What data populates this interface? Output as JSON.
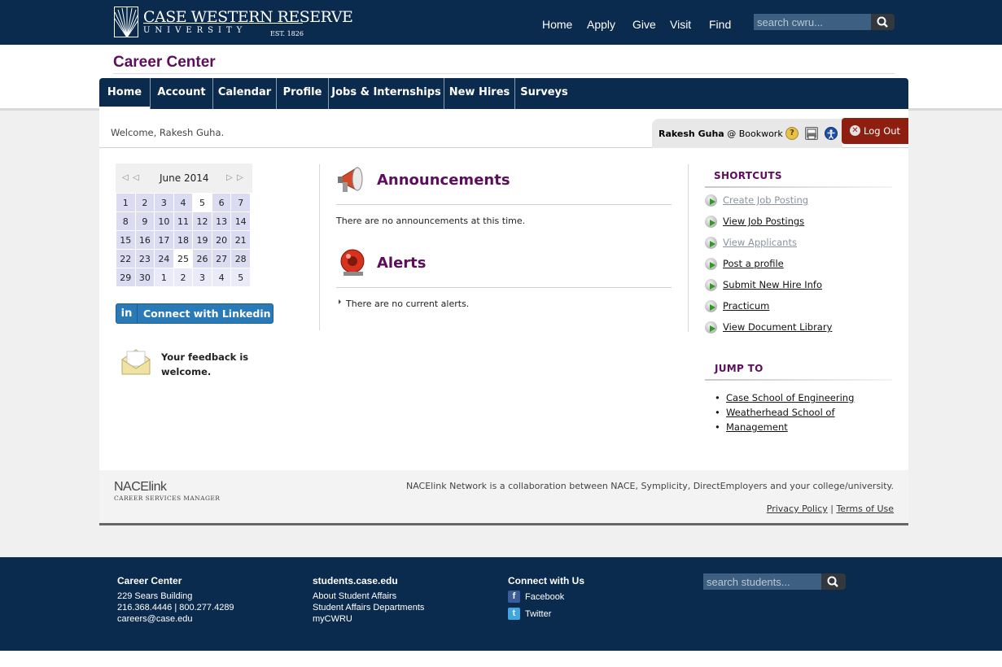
{
  "header": {
    "logo_line1": "CASE WESTERN RESERVE",
    "logo_line2": "UNIVERSITY",
    "logo_est": "EST. 1826",
    "nav": [
      "Home",
      "Apply",
      "Give",
      "Visit",
      "Find"
    ],
    "search_placeholder": "search cwru..."
  },
  "page_title": "Career Center",
  "main_nav": {
    "items": [
      "Home",
      "Account",
      "Calendar",
      "Profile",
      "Jobs & Internships",
      "New Hires",
      "Surveys"
    ],
    "active": "Home"
  },
  "welcome": "Welcome, Rakesh Guha.",
  "user": {
    "name": "Rakesh Guha",
    "org": "@ Bookwork",
    "icons": [
      "help-icon",
      "print-icon",
      "accessibility-icon"
    ]
  },
  "logout_label": "Log Out",
  "calendar": {
    "month_label": "June 2014",
    "today": "5",
    "weeks": [
      [
        "1",
        "2",
        "3",
        "4",
        "5",
        "6",
        "7"
      ],
      [
        "8",
        "9",
        "10",
        "11",
        "12",
        "13",
        "14"
      ],
      [
        "15",
        "16",
        "17",
        "18",
        "19",
        "20",
        "21"
      ],
      [
        "22",
        "23",
        "24",
        "25",
        "26",
        "27",
        "28"
      ],
      [
        "29",
        "30",
        "1",
        "2",
        "3",
        "4",
        "5"
      ]
    ]
  },
  "linkedin": {
    "badge": "in",
    "label": "Connect with Linkedin"
  },
  "feedback_label_line1": "Your feedback is",
  "feedback_label_line2": "welcome.",
  "announcements": {
    "title": "Announcements",
    "text": "There are no announcements at this time."
  },
  "alerts": {
    "title": "Alerts",
    "text": "There are no current alerts."
  },
  "shortcuts": {
    "heading": "SHORTCUTS",
    "items": [
      {
        "label": "Create Job Posting",
        "muted": true
      },
      {
        "label": "View Job Postings",
        "muted": false
      },
      {
        "label": "View Applicants",
        "muted": true
      },
      {
        "label": "Post a profile",
        "muted": false
      },
      {
        "label": "Submit New Hire Info",
        "muted": false
      },
      {
        "label": "Practicum",
        "muted": false
      },
      {
        "label": "View Document Library",
        "muted": false
      }
    ]
  },
  "jump_to": {
    "heading": "JUMP TO",
    "items": [
      "Case School of Engineering",
      "Weatherhead School of",
      "Management"
    ]
  },
  "card_footer": {
    "nace_line1": "NACElink",
    "nace_line2": "CAREER SERVICES MANAGER",
    "note": "NACElink Network is a collaboration between NACE, Symplicity, DirectEmployers and your college/university.",
    "privacy": "Privacy Policy",
    "separator": "|",
    "terms": "Terms of Use"
  },
  "footer": {
    "col1": {
      "heading": "Career Center",
      "lines": [
        "229 Sears Building",
        "216.368.4446 | 800.277.4289",
        "careers@case.edu"
      ]
    },
    "col2": {
      "heading": "students.case.edu",
      "lines": [
        "About Student Affairs",
        "Student Affairs Departments",
        "myCWRU"
      ]
    },
    "col3": {
      "heading": "Connect with Us",
      "facebook": "Facebook",
      "twitter": "Twitter",
      "facebook_glyph": "f",
      "twitter_glyph": "t"
    },
    "search_placeholder": "search students..."
  },
  "colors": {
    "navy": "#0b2b4e",
    "purple": "#5c0e5b",
    "logout_red": "#8e1f10",
    "linkedin_blue": "#2a7ab8",
    "calendar_cell": "#dbdbf1"
  }
}
